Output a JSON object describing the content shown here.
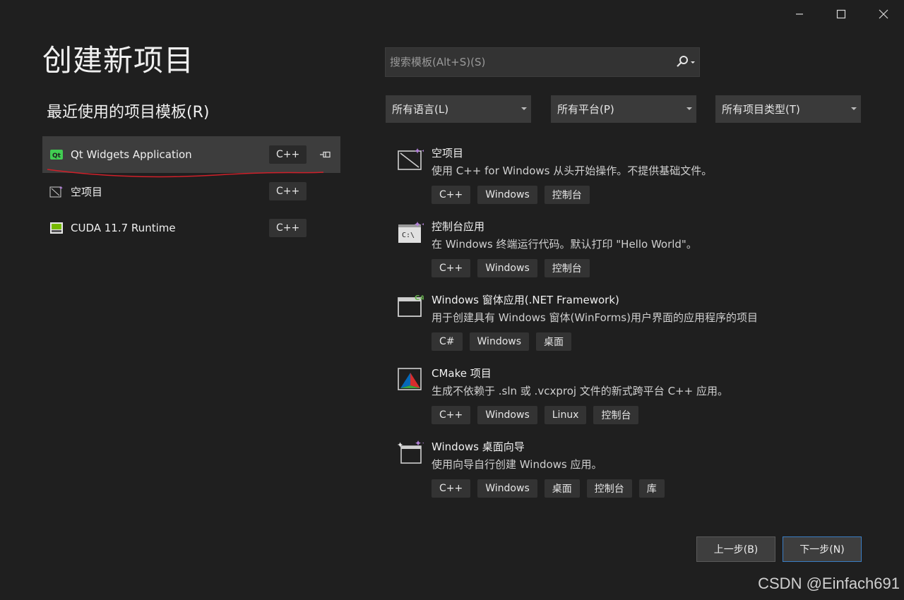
{
  "window": {
    "title": "创建新项目"
  },
  "recent": {
    "heading": "最近使用的项目模板(R)",
    "items": [
      {
        "label": "Qt Widgets Application",
        "tag": "C++",
        "icon": "qt-icon",
        "selected": true,
        "pinned": true
      },
      {
        "label": "空项目",
        "tag": "C++",
        "icon": "empty-project-icon"
      },
      {
        "label": "CUDA 11.7 Runtime",
        "tag": "C++",
        "icon": "cuda-icon"
      }
    ]
  },
  "search": {
    "placeholder": "搜索模板(Alt+S)(S)"
  },
  "filters": {
    "language": "所有语言(L)",
    "platform": "所有平台(P)",
    "project_type": "所有项目类型(T)"
  },
  "templates": [
    {
      "name": "空项目",
      "desc": "使用 C++ for Windows 从头开始操作。不提供基础文件。",
      "tags": [
        "C++",
        "Windows",
        "控制台"
      ],
      "icon": "empty-project-icon"
    },
    {
      "name": "控制台应用",
      "desc": "在 Windows 终端运行代码。默认打印 \"Hello World\"。",
      "tags": [
        "C++",
        "Windows",
        "控制台"
      ],
      "icon": "console-app-icon"
    },
    {
      "name": "Windows 窗体应用(.NET Framework)",
      "desc": "用于创建具有 Windows 窗体(WinForms)用户界面的应用程序的项目",
      "tags": [
        "C#",
        "Windows",
        "桌面"
      ],
      "icon": "winforms-icon"
    },
    {
      "name": "CMake 项目",
      "desc": "生成不依赖于 .sln 或 .vcxproj 文件的新式跨平台 C++ 应用。",
      "tags": [
        "C++",
        "Windows",
        "Linux",
        "控制台"
      ],
      "icon": "cmake-icon"
    },
    {
      "name": "Windows 桌面向导",
      "desc": "使用向导自行创建 Windows 应用。",
      "tags": [
        "C++",
        "Windows",
        "桌面",
        "控制台",
        "库"
      ],
      "icon": "desktop-wizard-icon"
    }
  ],
  "buttons": {
    "back": "上一步(B)",
    "next": "下一步(N)"
  },
  "watermark": "CSDN @Einfach691",
  "colors": {
    "background": "#1f1f1f",
    "selected": "#3d3d3d",
    "accent": "#3a7ec4",
    "annotation": "#d0202a"
  }
}
